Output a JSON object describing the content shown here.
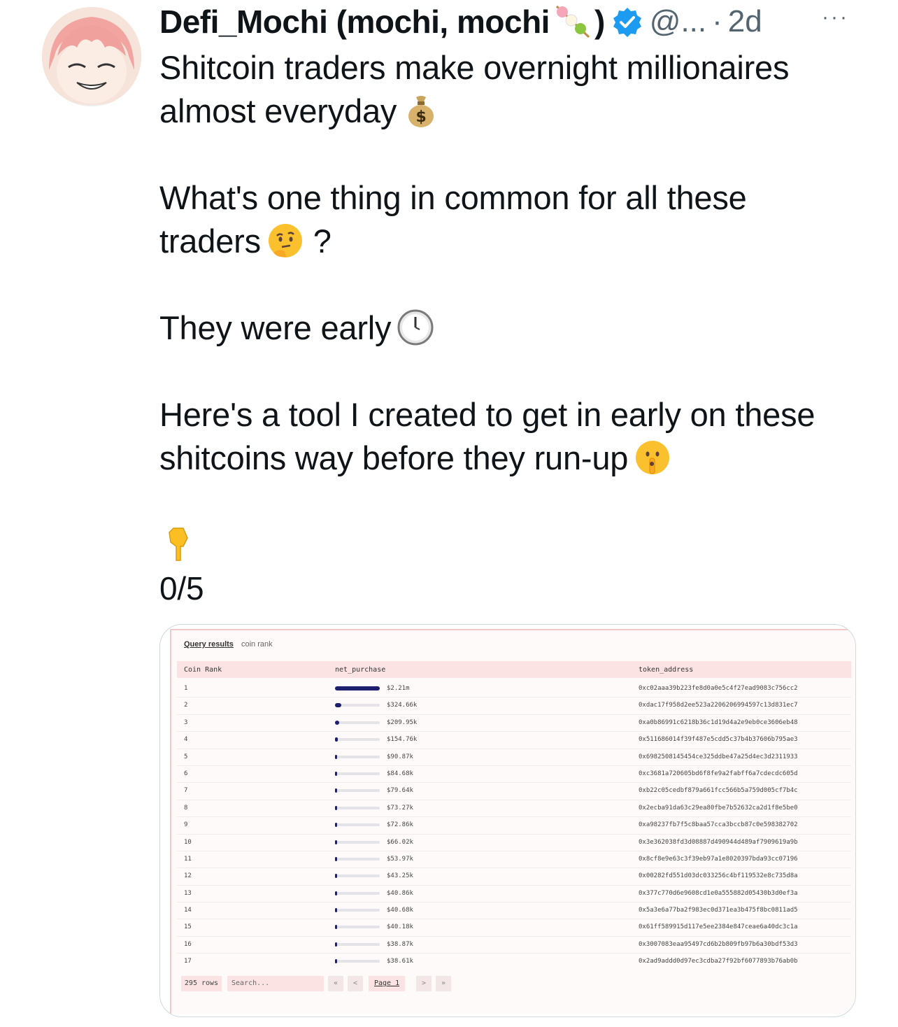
{
  "tweet": {
    "display_name": "Defi_Mochi (mochi, mochi",
    "display_name_close": ")",
    "handle": "@...",
    "separator": "·",
    "time": "2d",
    "more": "···",
    "lines": [
      "Shitcoin traders make overnight millionaires",
      "almost everyday",
      "What's one thing in common for all these",
      "traders",
      "?",
      "They were early",
      "Here's a tool I created to get in early on these",
      "shitcoins way before they run-up",
      "0/5"
    ],
    "icons": [
      "dango-icon",
      "verified-badge-icon",
      "money-bag-icon",
      "thinking-face-icon",
      "clock-icon",
      "shushing-face-icon",
      "pointing-down-icon"
    ]
  },
  "query": {
    "link": "Query results",
    "subtitle": "coin rank",
    "columns": [
      "Coin Rank",
      "net_purchase",
      "token_address"
    ],
    "rows": [
      {
        "rank": "1",
        "net": "$2.21m",
        "fill": 1.0,
        "addr": "0xc02aaa39b223fe8d0a0e5c4f27ead9083c756cc2"
      },
      {
        "rank": "2",
        "net": "$324.66k",
        "fill": 0.147,
        "addr": "0xdac17f958d2ee523a2206206994597c13d831ec7"
      },
      {
        "rank": "3",
        "net": "$209.95k",
        "fill": 0.095,
        "addr": "0xa0b86991c6218b36c1d19d4a2e9eb0ce3606eb48"
      },
      {
        "rank": "4",
        "net": "$154.76k",
        "fill": 0.07,
        "addr": "0x511686014f39f487e5cdd5c37b4b37606b795ae3"
      },
      {
        "rank": "5",
        "net": "$90.87k",
        "fill": 0.041,
        "addr": "0x6982508145454ce325ddbe47a25d4ec3d2311933"
      },
      {
        "rank": "6",
        "net": "$84.68k",
        "fill": 0.038,
        "addr": "0xc3681a720605bd6f8fe9a2fabff6a7cdecdc605d"
      },
      {
        "rank": "7",
        "net": "$79.64k",
        "fill": 0.036,
        "addr": "0xb22c05cedbf879a661fcc566b5a759d005cf7b4c"
      },
      {
        "rank": "8",
        "net": "$73.27k",
        "fill": 0.033,
        "addr": "0x2ecba91da63c29ea80fbe7b52632ca2d1f8e5be0"
      },
      {
        "rank": "9",
        "net": "$72.86k",
        "fill": 0.033,
        "addr": "0xa98237fb7f5c8baa57cca3bccb87c0e598382702"
      },
      {
        "rank": "10",
        "net": "$66.02k",
        "fill": 0.03,
        "addr": "0x3e362038fd3d08887d490944d489af7909619a9b"
      },
      {
        "rank": "11",
        "net": "$53.97k",
        "fill": 0.024,
        "addr": "0x8cf8e9e63c3f39eb97a1e8020397bda93cc07196"
      },
      {
        "rank": "12",
        "net": "$43.25k",
        "fill": 0.02,
        "addr": "0x00282fd551d03dc033256c4bf119532e8c735d8a"
      },
      {
        "rank": "13",
        "net": "$40.86k",
        "fill": 0.018,
        "addr": "0x377c770d6e9608cd1e0a555882d05430b3d0ef3a"
      },
      {
        "rank": "14",
        "net": "$40.68k",
        "fill": 0.018,
        "addr": "0x5a3e6a77ba2f983ec0d371ea3b475f8bc0811ad5"
      },
      {
        "rank": "15",
        "net": "$40.18k",
        "fill": 0.018,
        "addr": "0x61ff589915d117e5ee2384e847ceae6a40dc3c1a"
      },
      {
        "rank": "16",
        "net": "$38.87k",
        "fill": 0.018,
        "addr": "0x3007083eaa95497cd6b2b809fb97b6a30bdf53d3"
      },
      {
        "rank": "17",
        "net": "$38.61k",
        "fill": 0.017,
        "addr": "0x2ad9addd0d97ec3cdba27f92bf6077893b76ab0b"
      }
    ],
    "footer": {
      "rows_count": "295 rows",
      "search_placeholder": "Search...",
      "first": "«",
      "prev": "<",
      "page": "Page 1",
      "next": ">",
      "last": "»"
    }
  }
}
